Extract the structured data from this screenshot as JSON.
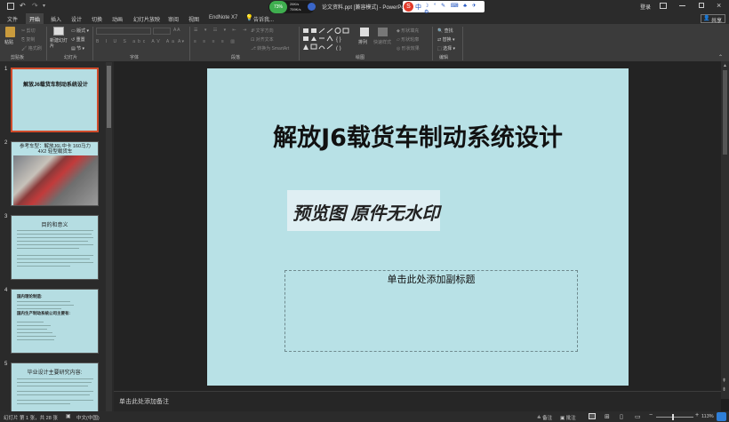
{
  "titlebar": {
    "title": "论文资料.ppt [兼容模式] - PowerPoint",
    "login": "登录",
    "sogou": "S中",
    "net_speed_up": "26K/s",
    "net_speed_down": "759K/s",
    "cpu": "73%"
  },
  "tabs": [
    "文件",
    "开始",
    "插入",
    "设计",
    "切换",
    "动画",
    "幻灯片放映",
    "审阅",
    "视图",
    "EndNote X7",
    "告诉我..."
  ],
  "active_tab": "开始",
  "share_label": "共享",
  "ribbon": {
    "clipboard": {
      "label": "剪贴板",
      "paste": "粘贴",
      "cut": "剪切",
      "copy": "复制",
      "format_painter": "格式刷"
    },
    "slides": {
      "label": "幻灯片",
      "new_slide": "新建幻灯片",
      "layout": "版式",
      "reset": "重置",
      "section": "节"
    },
    "font": {
      "label": "字体"
    },
    "paragraph": {
      "label": "段落",
      "text_direction": "文字方向",
      "align_text": "对齐文本",
      "smartart": "转换为 SmartArt"
    },
    "drawing": {
      "label": "绘图",
      "arrange": "排列",
      "quick_styles": "快速样式",
      "fill": "形状填充",
      "outline": "形状轮廓",
      "effects": "形状效果"
    },
    "editing": {
      "label": "编辑",
      "find": "查找",
      "replace": "替换",
      "select": "选择"
    }
  },
  "thumbnails": [
    {
      "num": "1",
      "title": "解放J6载货车制动系统设计"
    },
    {
      "num": "2",
      "title": "参考车型：解放J6L中卡 160马力 4X2 轻型载货车"
    },
    {
      "num": "3",
      "title": "目的和意义"
    },
    {
      "num": "4",
      "title": "国内理论制造:",
      "subtitle": "国内生产制动系统公司主要有:"
    },
    {
      "num": "5",
      "title": "毕业设计主要研究内容:"
    }
  ],
  "slide": {
    "title": "解放J6载货车制动系统设计",
    "watermark": "预览图 原件无水印",
    "subtitle_placeholder": "单击此处添加副标题"
  },
  "notes_placeholder": "单击此处添加备注",
  "status": {
    "slide_info": "幻灯片 第 1 张，共 28 张",
    "language": "中文(中国)",
    "notes": "备注",
    "comments": "批注",
    "zoom": "113%",
    "zoom_level": 113
  },
  "colors": {
    "slide_bg": "#b8e1e6",
    "selected_border": "#d04b2b",
    "sogou_red": "#e23a2a"
  }
}
